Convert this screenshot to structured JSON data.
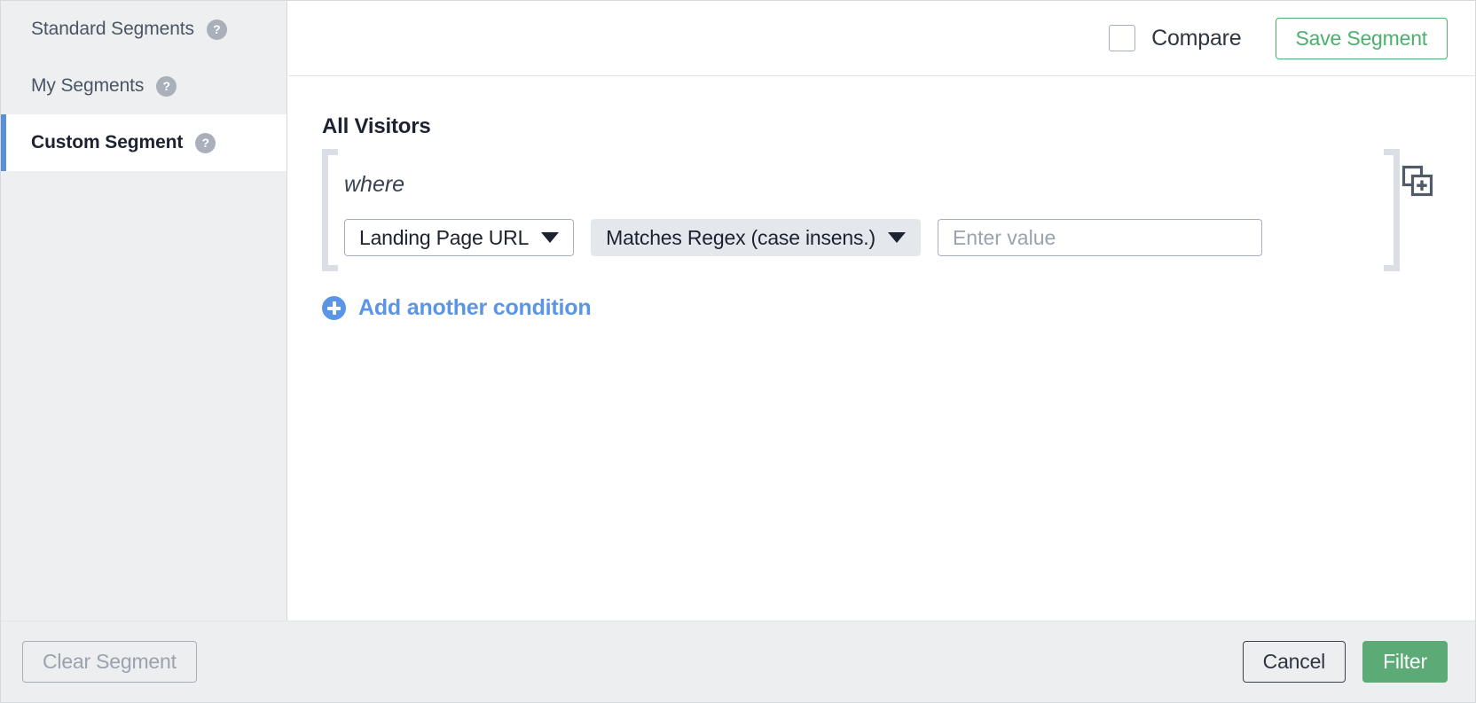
{
  "sidebar": {
    "items": [
      {
        "label": "Standard Segments",
        "help_icon": "question-mark-icon",
        "selected": false
      },
      {
        "label": "My Segments",
        "help_icon": "question-mark-icon",
        "selected": false
      },
      {
        "label": "Custom Segment",
        "help_icon": "question-mark-icon",
        "selected": true
      }
    ]
  },
  "header": {
    "compare_label": "Compare",
    "compare_checked": false,
    "save_segment_label": "Save Segment"
  },
  "main": {
    "segment_title": "All Visitors",
    "where_label": "where",
    "condition": {
      "field": "Landing Page URL",
      "field_caret_icon": "chevron-down-icon",
      "operator": "Matches Regex (case insens.)",
      "operator_caret_icon": "chevron-down-icon",
      "value": "",
      "value_placeholder": "Enter value"
    },
    "duplicate_icon": "duplicate-add-icon",
    "add_condition_label": "Add another condition",
    "add_condition_icon": "plus-circle-icon"
  },
  "footer": {
    "clear_label": "Clear Segment",
    "cancel_label": "Cancel",
    "filter_label": "Filter"
  },
  "colors": {
    "accent_blue": "#5b8fd6",
    "link_blue": "#5b95e8",
    "save_green": "#4caf6d",
    "filter_green": "#5cab77",
    "sidebar_bg": "#edeff1",
    "footer_bg": "#eceef0",
    "bracket_gray": "#dbdfe5",
    "operator_bg": "#e4e7ec"
  }
}
